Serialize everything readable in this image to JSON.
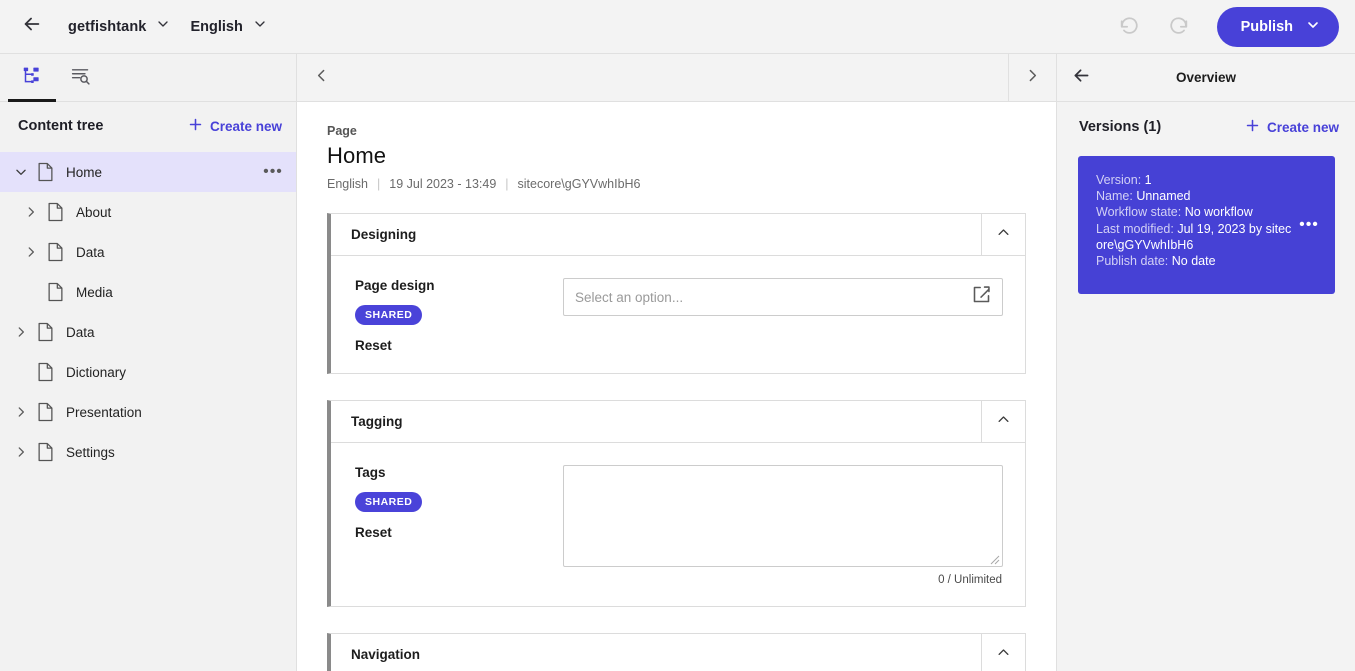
{
  "topbar": {
    "back_icon": "arrow-left-icon",
    "site_name": "getfishtank",
    "language": "English",
    "undo_icon": "undo-icon",
    "redo_icon": "redo-icon",
    "publish_label": "Publish"
  },
  "sidebar": {
    "tabs": [
      {
        "name": "content-tree-tab",
        "icon": "sitemap-icon",
        "active": true
      },
      {
        "name": "search-filter-tab",
        "icon": "search-filter-icon",
        "active": false
      }
    ],
    "header": {
      "title": "Content tree",
      "create_new_label": "Create new"
    },
    "tree": [
      {
        "label": "Home",
        "depth": 0,
        "toggle": "chevron-down-icon",
        "selected": true,
        "has_more": true
      },
      {
        "label": "About",
        "depth": 1,
        "toggle": "chevron-right-icon",
        "selected": false,
        "has_more": false
      },
      {
        "label": "Data",
        "depth": 1,
        "toggle": "chevron-right-icon",
        "selected": false,
        "has_more": false
      },
      {
        "label": "Media",
        "depth": 1,
        "toggle": "none",
        "selected": false,
        "has_more": false
      },
      {
        "label": "Data",
        "depth": 0,
        "toggle": "chevron-right-icon",
        "selected": false,
        "has_more": false
      },
      {
        "label": "Dictionary",
        "depth": 0,
        "toggle": "none",
        "selected": false,
        "has_more": false
      },
      {
        "label": "Presentation",
        "depth": 0,
        "toggle": "chevron-right-icon",
        "selected": false,
        "has_more": false
      },
      {
        "label": "Settings",
        "depth": 0,
        "toggle": "chevron-right-icon",
        "selected": false,
        "has_more": false
      }
    ]
  },
  "main": {
    "nav": {
      "prev_icon": "chevron-left-icon",
      "next_icon": "chevron-right-icon"
    },
    "page": {
      "kicker": "Page",
      "title": "Home",
      "meta_language": "English",
      "meta_date": "19 Jul 2023 - 13:49",
      "meta_user": "sitecore\\gGYVwhIbH6"
    },
    "panels": [
      {
        "title": "Designing",
        "collapse_icon": "chevron-up-icon",
        "field_label": "Page design",
        "badge": "SHARED",
        "reset_label": "Reset",
        "control": "select",
        "placeholder": "Select an option...",
        "value": "",
        "control_icon": "edit-square-icon"
      },
      {
        "title": "Tagging",
        "collapse_icon": "chevron-up-icon",
        "field_label": "Tags",
        "badge": "SHARED",
        "reset_label": "Reset",
        "control": "textarea",
        "placeholder": "",
        "value": "",
        "char_count": "0 / Unlimited"
      },
      {
        "title": "Navigation",
        "collapse_icon": "chevron-up-icon",
        "field_label": "",
        "badge": "",
        "reset_label": "",
        "control": "none"
      }
    ]
  },
  "rightbar": {
    "back_icon": "arrow-left-icon",
    "title": "Overview",
    "versions_title": "Versions (1)",
    "create_new_label": "Create new",
    "version_card": {
      "version_label": "Version:",
      "version_value": "1",
      "name_label": "Name:",
      "name_value": "Unnamed",
      "workflow_label": "Workflow state:",
      "workflow_value": "No workflow",
      "modified_label": "Last modified:",
      "modified_value": "Jul 19, 2023 by sitecore\\gGYVwhIbH6",
      "publish_label": "Publish date:",
      "publish_value": "No date",
      "more_icon": "ellipsis-icon"
    }
  },
  "colors": {
    "accent": "#4841d8",
    "card": "#4641d5",
    "badge": "#4a43d9",
    "selected_row": "#e4e1fb"
  }
}
